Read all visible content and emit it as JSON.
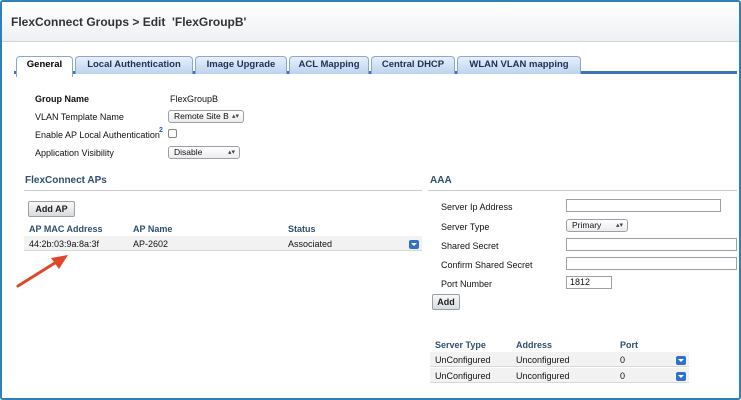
{
  "header": {
    "title": "FlexConnect Groups > Edit  'FlexGroupB'"
  },
  "tabs": [
    {
      "label": "General"
    },
    {
      "label": "Local Authentication"
    },
    {
      "label": "Image Upgrade"
    },
    {
      "label": "ACL Mapping"
    },
    {
      "label": "Central DHCP"
    },
    {
      "label": "WLAN VLAN mapping"
    }
  ],
  "general": {
    "group_name_label": "Group Name",
    "group_name_value": "FlexGroupB",
    "vlan_template_label": "VLAN Template Name",
    "vlan_template_value": "Remote Site B",
    "local_auth_label": "Enable AP Local Authentication",
    "local_auth_help": "2",
    "app_visibility_label": "Application Visibility",
    "app_visibility_value": "Disable"
  },
  "flexconnect_aps": {
    "title": "FlexConnect APs",
    "add_button": "Add AP",
    "columns": [
      "AP MAC Address",
      "AP Name",
      "Status"
    ],
    "rows": [
      {
        "mac": "44:2b:03:9a:8a:3f",
        "name": "AP-2602",
        "status": "Associated"
      }
    ]
  },
  "aaa": {
    "title": "AAA",
    "server_ip_label": "Server Ip Address",
    "server_ip_value": "",
    "server_type_label": "Server Type",
    "server_type_value": "Primary",
    "shared_secret_label": "Shared Secret",
    "confirm_secret_label": "Confirm Shared Secret",
    "port_label": "Port Number",
    "port_value": "1812",
    "add_button": "Add",
    "columns": [
      "Server Type",
      "Address",
      "Port"
    ],
    "rows": [
      {
        "type": "UnConfigured",
        "address": "Unconfigured",
        "port": "0"
      },
      {
        "type": "UnConfigured",
        "address": "Unconfigured",
        "port": "0"
      }
    ]
  },
  "colors": {
    "accent": "#3f73b8",
    "section_title": "#2f4f6e",
    "annotation_arrow": "#e0462a"
  }
}
